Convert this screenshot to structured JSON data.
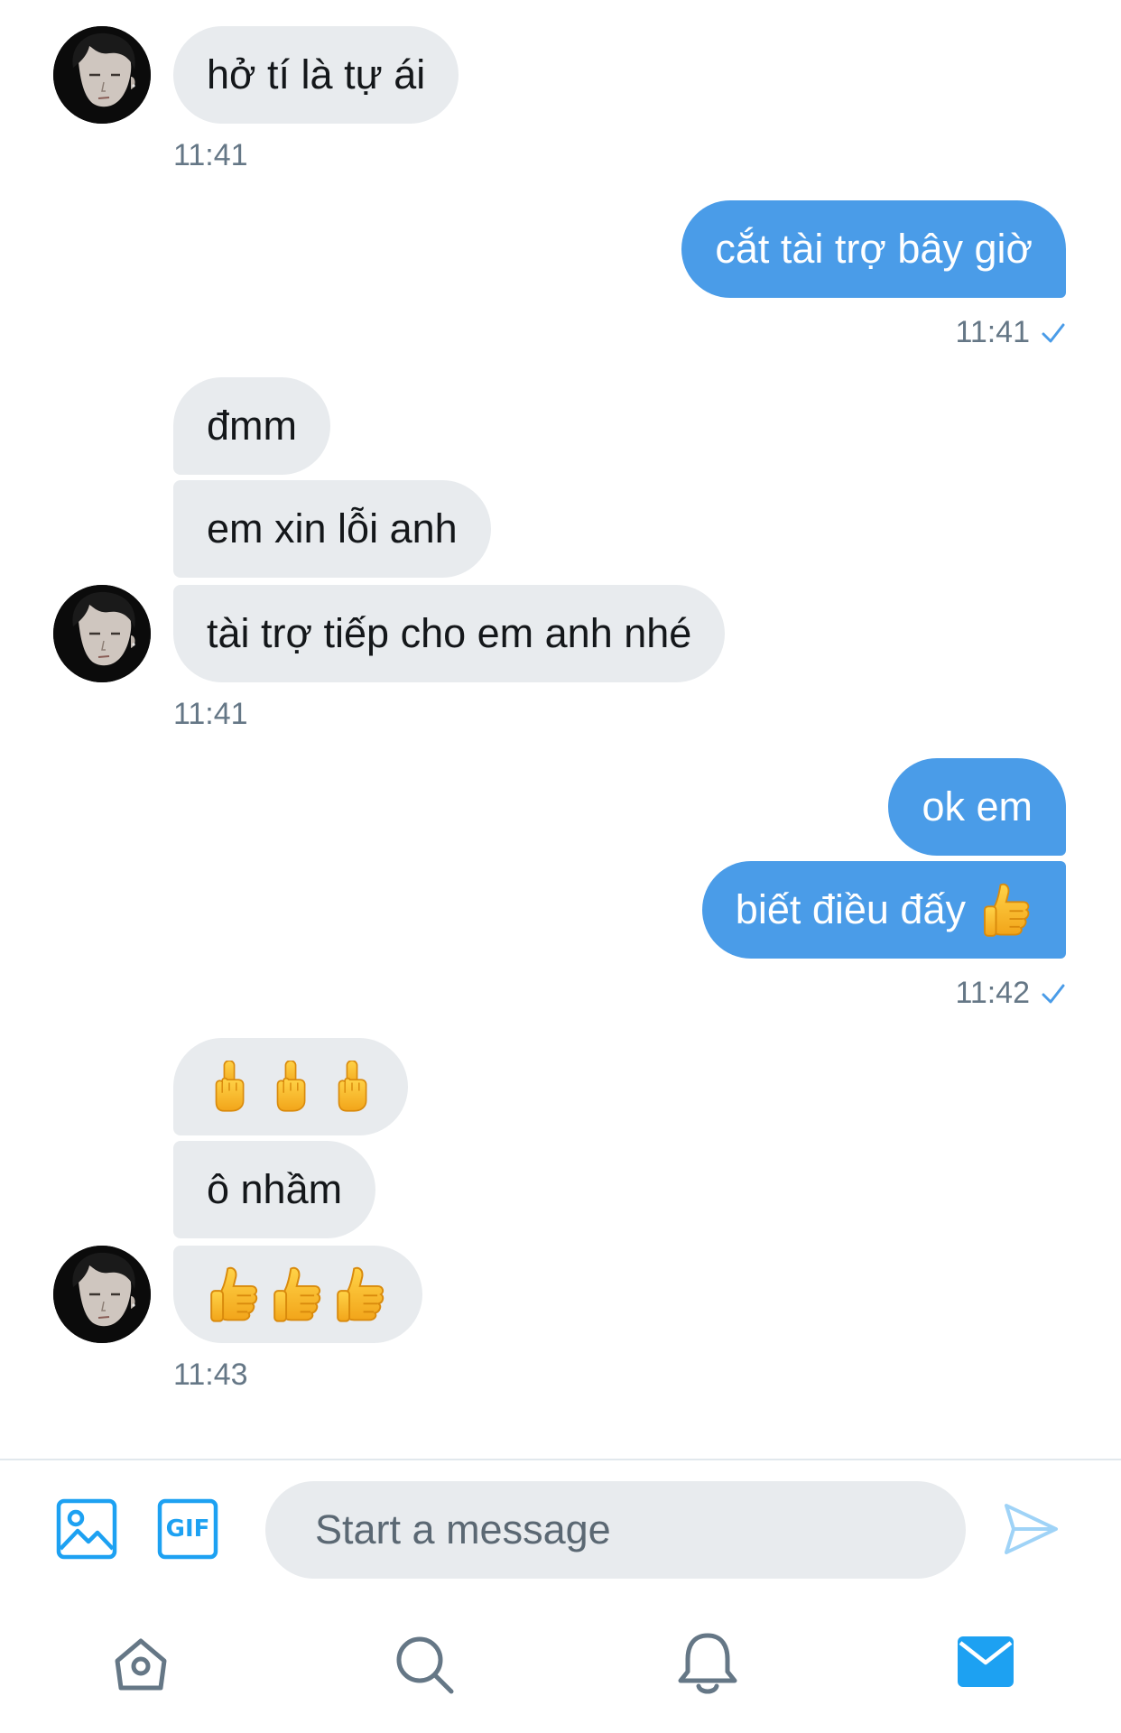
{
  "conversation": {
    "groups": [
      {
        "sender": "other",
        "messages": [
          "hở tí là tự ái"
        ],
        "time": "11:41"
      },
      {
        "sender": "me",
        "messages": [
          "cắt tài trợ bây giờ"
        ],
        "time": "11:41",
        "status": "sent"
      },
      {
        "sender": "other",
        "messages": [
          "đmm",
          "em xin lỗi anh",
          "tài trợ tiếp cho em anh nhé"
        ],
        "time": "11:41"
      },
      {
        "sender": "me",
        "messages": [
          "ok em",
          "biết điều đấy"
        ],
        "emoji_after_last": "thumbs-up",
        "time": "11:42",
        "status": "sent"
      },
      {
        "sender": "other",
        "messages": [
          "",
          "ô nhầm",
          ""
        ],
        "emoji_messages": [
          "middle-finger x3",
          "",
          "thumbs-up x3"
        ],
        "time": "11:43"
      }
    ]
  },
  "composer": {
    "placeholder": "Start a message",
    "gif_label": "GIF",
    "icons": [
      "image-icon",
      "gif-icon",
      "send-icon"
    ]
  },
  "tabbar": {
    "icons": [
      "home-icon",
      "search-icon",
      "notifications-icon",
      "messages-icon"
    ],
    "active": "messages-icon"
  },
  "colors": {
    "accent": "#1da1f2",
    "outgoing_bubble": "#4a9ce8",
    "incoming_bubble": "#e8ebee",
    "timestamp": "#657786"
  }
}
